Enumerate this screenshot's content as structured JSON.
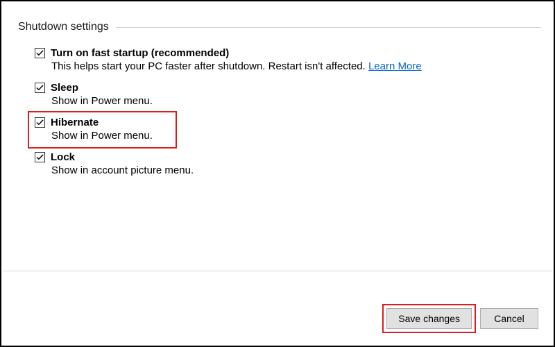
{
  "section": {
    "title": "Shutdown settings"
  },
  "options": {
    "fastStartup": {
      "label": "Turn on fast startup (recommended)",
      "description": "This helps start your PC faster after shutdown. Restart isn't affected.",
      "linkText": "Learn More",
      "checked": true
    },
    "sleep": {
      "label": "Sleep",
      "description": "Show in Power menu.",
      "checked": true
    },
    "hibernate": {
      "label": "Hibernate",
      "description": "Show in Power menu.",
      "checked": true
    },
    "lock": {
      "label": "Lock",
      "description": "Show in account picture menu.",
      "checked": true
    }
  },
  "buttons": {
    "save": "Save changes",
    "cancel": "Cancel"
  }
}
